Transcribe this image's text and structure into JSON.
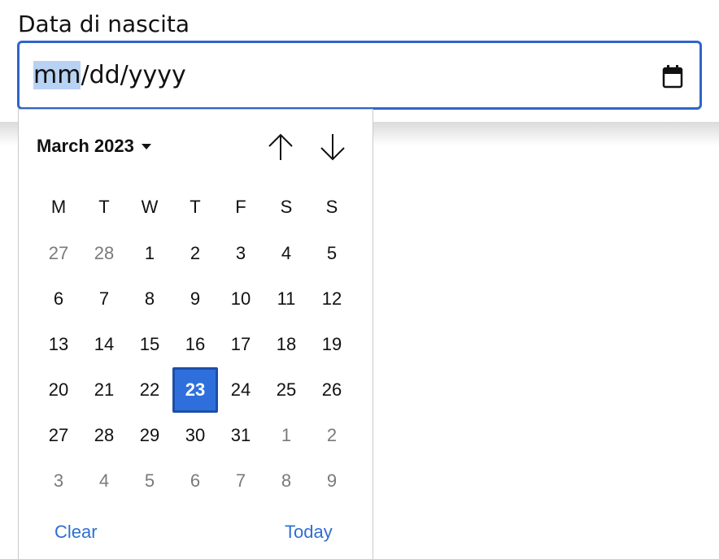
{
  "field": {
    "label": "Data di nascita",
    "segment_month": "mm",
    "separator_1": "/",
    "segment_day": "dd",
    "separator_2": "/",
    "segment_year": "yyyy",
    "icon": "calendar-icon"
  },
  "picker": {
    "month_label": "March 2023",
    "weekdays": [
      "M",
      "T",
      "W",
      "T",
      "F",
      "S",
      "S"
    ],
    "weeks": [
      [
        "27",
        "28",
        "1",
        "2",
        "3",
        "4",
        "5"
      ],
      [
        "6",
        "7",
        "8",
        "9",
        "10",
        "11",
        "12"
      ],
      [
        "13",
        "14",
        "15",
        "16",
        "17",
        "18",
        "19"
      ],
      [
        "20",
        "21",
        "22",
        "23",
        "24",
        "25",
        "26"
      ],
      [
        "27",
        "28",
        "29",
        "30",
        "31",
        "1",
        "2"
      ],
      [
        "3",
        "4",
        "5",
        "6",
        "7",
        "8",
        "9"
      ]
    ],
    "muted_days": [
      [
        0,
        0
      ],
      [
        0,
        1
      ],
      [
        4,
        5
      ],
      [
        4,
        6
      ],
      [
        5,
        0
      ],
      [
        5,
        1
      ],
      [
        5,
        2
      ],
      [
        5,
        3
      ],
      [
        5,
        4
      ],
      [
        5,
        5
      ],
      [
        5,
        6
      ]
    ],
    "selected_day": [
      3,
      3
    ],
    "clear_label": "Clear",
    "today_label": "Today"
  },
  "colors": {
    "accent": "#2e6fdc",
    "link": "#2f6fd0",
    "focus_border": "#2f65c9",
    "segment_highlight": "#b8d2f4"
  }
}
